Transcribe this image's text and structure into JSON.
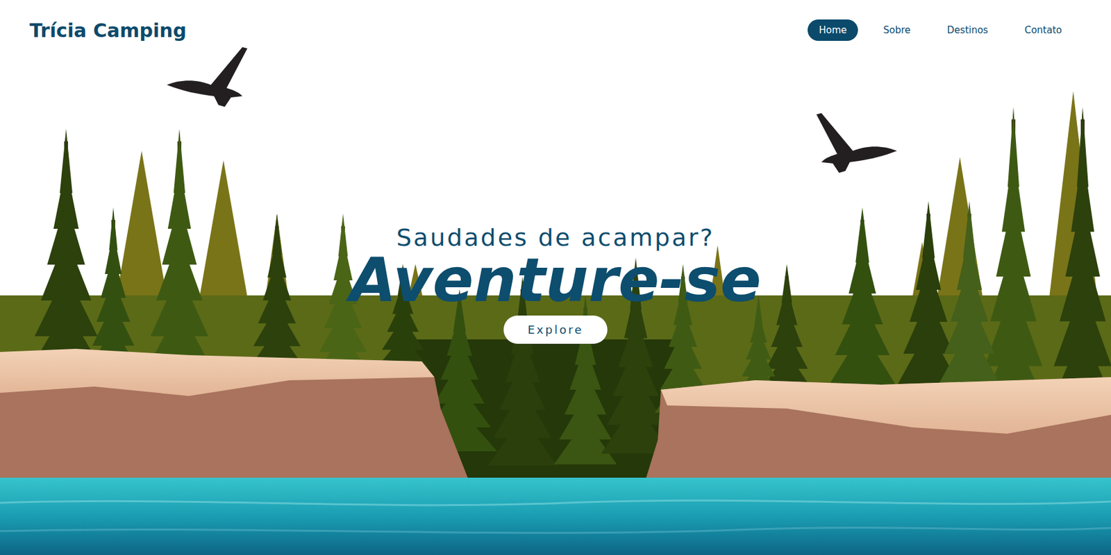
{
  "header": {
    "logo": "Trícia Camping"
  },
  "nav": [
    {
      "label": "Home",
      "selected": true
    },
    {
      "label": "Sobre",
      "selected": false
    },
    {
      "label": "Destinos",
      "selected": false
    },
    {
      "label": "Contato",
      "selected": false
    }
  ],
  "hero": {
    "subtitle": "Saudades de acampar?",
    "title": "Aventure-se",
    "button": "Explore"
  }
}
